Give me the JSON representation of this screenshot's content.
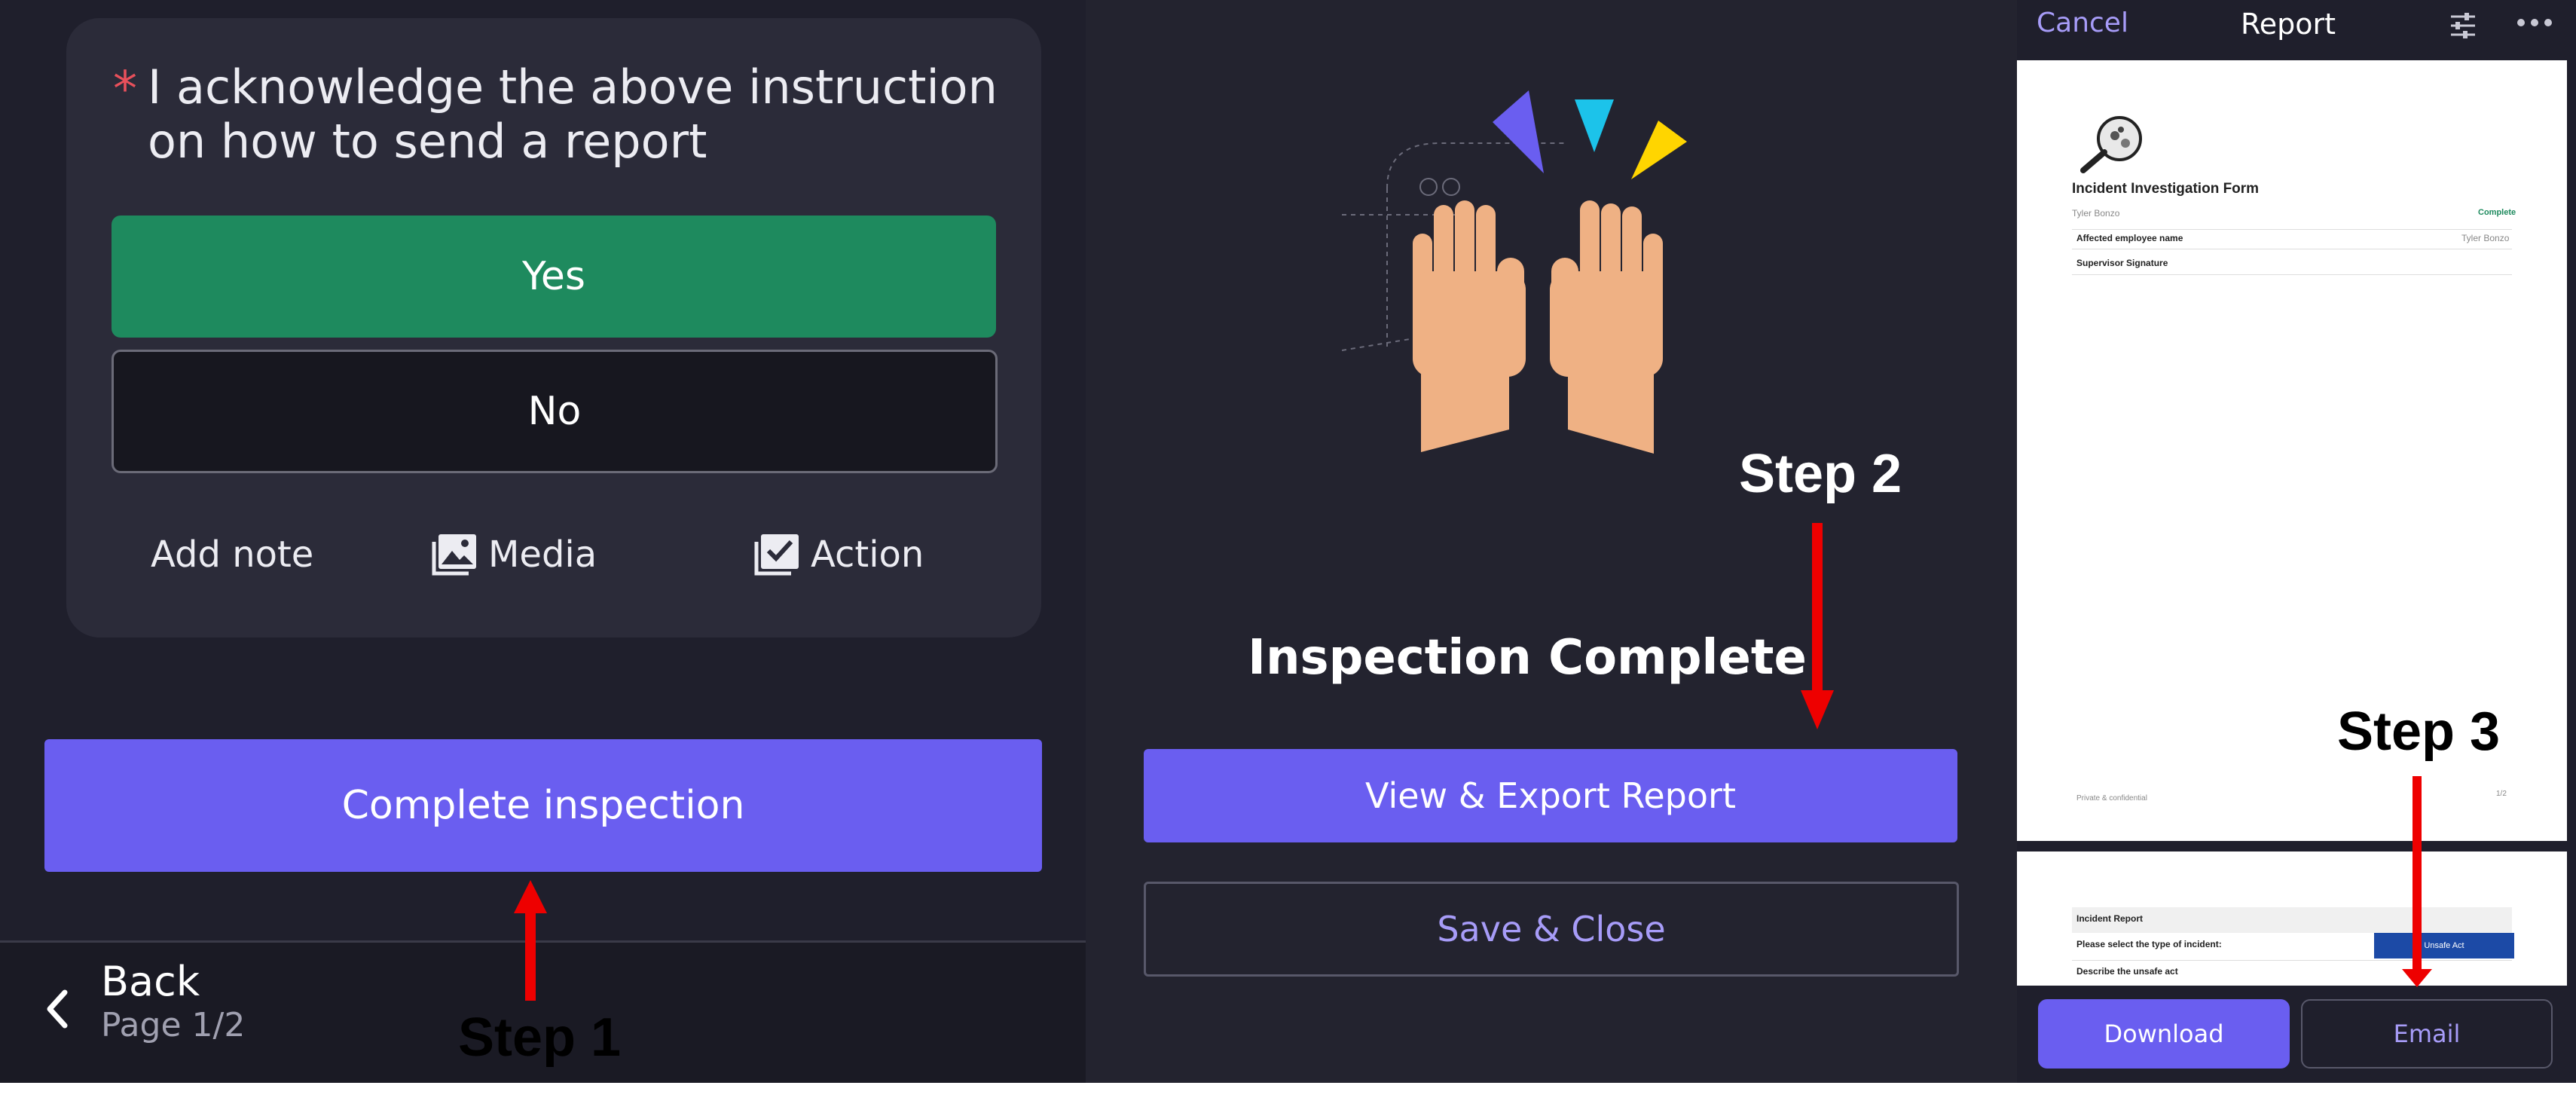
{
  "panel1": {
    "question": {
      "required_marker": "*",
      "text": "I acknowledge the above instruction on how to send a report"
    },
    "yes_label": "Yes",
    "no_label": "No",
    "add_note_label": "Add note",
    "media_label": "Media",
    "action_label": "Action",
    "complete_label": "Complete inspection",
    "back_label": "Back",
    "page_label": "Page 1/2"
  },
  "panel2": {
    "title": "Inspection Complete",
    "view_export_label": "View & Export Report",
    "save_close_label": "Save & Close"
  },
  "panel3": {
    "cancel_label": "Cancel",
    "title": "Report",
    "page1": {
      "form_title": "Incident Investigation Form",
      "author": "Tyler Bonzo",
      "status": "Complete",
      "row1_label": "Affected employee name",
      "row1_value": "Tyler Bonzo",
      "row2_label": "Supervisor Signature",
      "footer_left": "Private & confidential",
      "footer_right": "1/2"
    },
    "page2": {
      "section": "Incident Report",
      "q1_label": "Please select the type of incident:",
      "q1_value": "Unsafe Act",
      "q2_label": "Describe the unsafe act"
    },
    "download_label": "Download",
    "email_label": "Email"
  },
  "annotations": {
    "step1": "Step 1",
    "step2": "Step 2",
    "step3": "Step 3"
  },
  "colors": {
    "accent": "#6a5ef0",
    "yes_green": "#1e8a5e",
    "annotation_arrow": "#ee0000"
  }
}
